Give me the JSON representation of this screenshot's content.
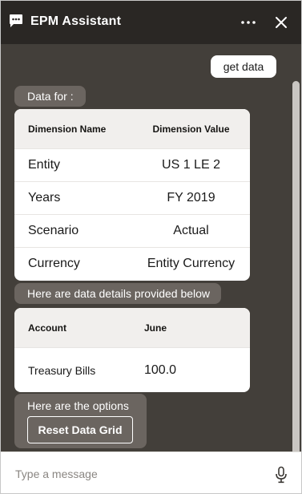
{
  "header": {
    "title": "EPM Assistant",
    "icons": [
      "chat-bubble-icon",
      "more-options-icon",
      "close-icon"
    ]
  },
  "conversation": {
    "user_message": "get data",
    "bot_intro": "Data for :",
    "dimension_table": {
      "headers": [
        "Dimension Name",
        "Dimension Value"
      ],
      "rows": [
        {
          "name": "Entity",
          "value": "US 1 LE 2"
        },
        {
          "name": "Years",
          "value": "FY 2019"
        },
        {
          "name": "Scenario",
          "value": "Actual"
        },
        {
          "name": "Currency",
          "value": "Entity Currency"
        }
      ]
    },
    "details_message": "Here are data details provided below",
    "account_table": {
      "headers": [
        "Account",
        "June"
      ],
      "rows": [
        {
          "account": "Treasury Bills",
          "value": "100.0"
        }
      ]
    },
    "options_message": "Here are the options",
    "options": [
      {
        "label": "Reset Data Grid"
      }
    ]
  },
  "footer": {
    "input_placeholder": "Type a message",
    "input_value": "",
    "mic_icon": "microphone-icon"
  }
}
